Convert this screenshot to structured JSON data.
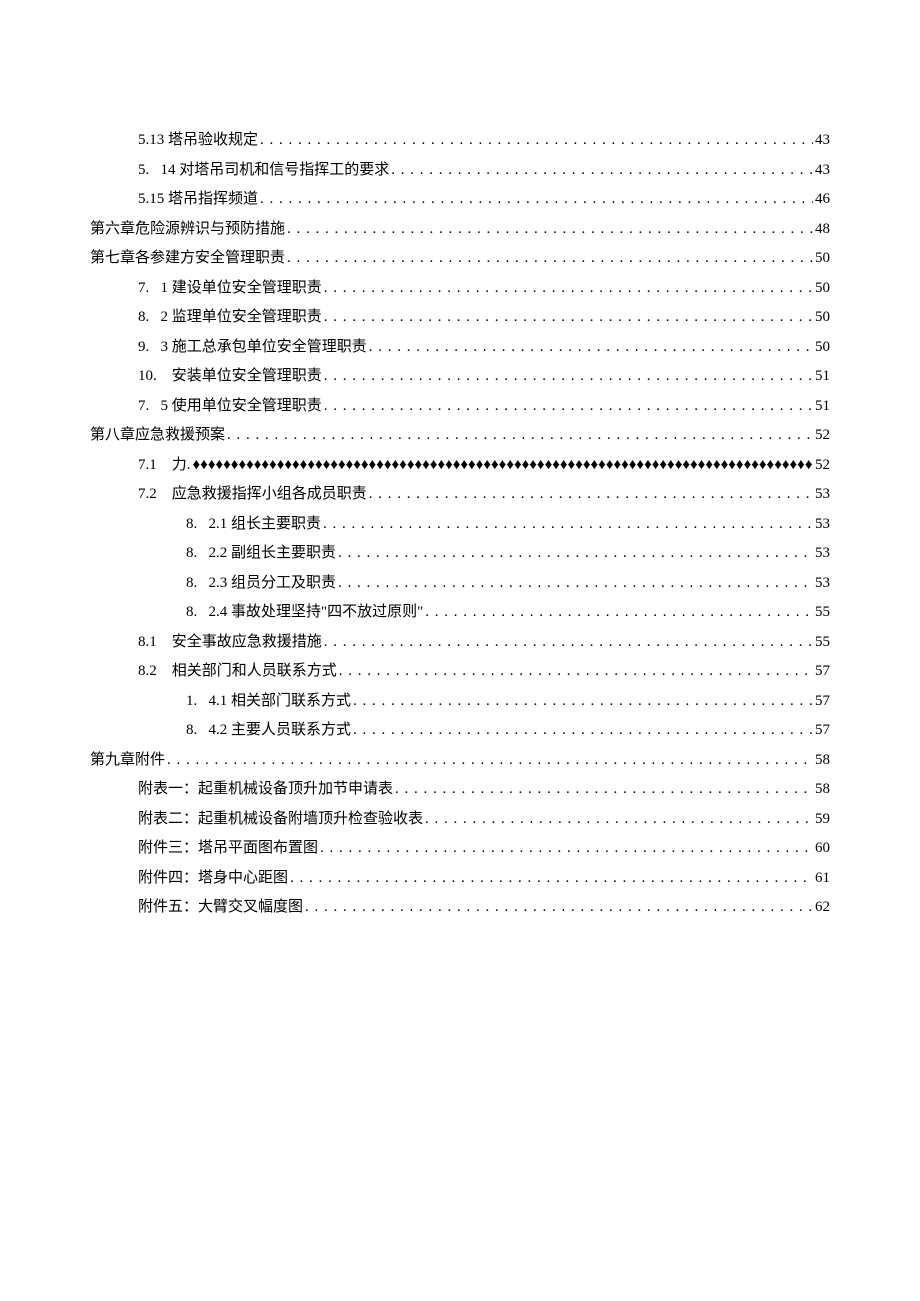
{
  "toc": [
    {
      "indent": 1,
      "prefix": "",
      "title": "5.13 塔吊验收规定",
      "page": "43",
      "leader": "dots"
    },
    {
      "indent": 1,
      "prefix": "5.   ",
      "title": "14 对塔吊司机和信号指挥工的要求",
      "page": "43",
      "leader": "dots"
    },
    {
      "indent": 1,
      "prefix": "",
      "title": "5.15 塔吊指挥频道",
      "page": "46",
      "leader": "dots"
    },
    {
      "indent": 0,
      "prefix": "",
      "title": "第六章危险源辨识与预防措施 ",
      "page": "48",
      "leader": "dots"
    },
    {
      "indent": 0,
      "prefix": "",
      "title": "第七章各参建方安全管理职责 ",
      "page": "50",
      "leader": "dots"
    },
    {
      "indent": 1,
      "prefix": "7.   ",
      "title": "1 建设单位安全管理职责",
      "page": "50",
      "leader": "dots"
    },
    {
      "indent": 1,
      "prefix": "8.   ",
      "title": "2 监理单位安全管理职责",
      "page": "50",
      "leader": "dots"
    },
    {
      "indent": 1,
      "prefix": "9.   ",
      "title": "3 施工总承包单位安全管理职责",
      "page": "50",
      "leader": "dots"
    },
    {
      "indent": 1,
      "prefix": "10.    ",
      "title": "安装单位安全管理职责 ",
      "page": "51",
      "leader": "dots"
    },
    {
      "indent": 1,
      "prefix": "7.   ",
      "title": "5 使用单位安全管理职责",
      "page": "51",
      "leader": "dots"
    },
    {
      "indent": 0,
      "prefix": "",
      "title": "第八章应急救援预案 ",
      "page": "52",
      "leader": "dots"
    },
    {
      "indent": 1,
      "prefix": "7.1    ",
      "title": "力.      ",
      "page": "52",
      "leader": "diamonds"
    },
    {
      "indent": 1,
      "prefix": "7.2    ",
      "title": "应急救援指挥小组各成员职责",
      "page": "53",
      "leader": "dots"
    },
    {
      "indent": 2,
      "prefix": "8.   ",
      "title": "2.1 组长主要职责 ",
      "page": "53",
      "leader": "dots"
    },
    {
      "indent": 2,
      "prefix": "8.   ",
      "title": "2.2 副组长主要职责 ",
      "page": "53",
      "leader": "dots"
    },
    {
      "indent": 2,
      "prefix": "8.   ",
      "title": "2.3 组员分工及职责 ",
      "page": "53",
      "leader": "dots"
    },
    {
      "indent": 2,
      "prefix": "8.   ",
      "title": "2.4 事故处理坚持\"四不放过原则\" ",
      "page": "55",
      "leader": "dots"
    },
    {
      "indent": 1,
      "prefix": "8.1    ",
      "title": "安全事故应急救援措施",
      "page": "55",
      "leader": "dots"
    },
    {
      "indent": 1,
      "prefix": "8.2    ",
      "title": "相关部门和人员联系方式",
      "page": "57",
      "leader": "dots"
    },
    {
      "indent": 2,
      "prefix": "1.   ",
      "title": "4.1 相关部门联系方式 ",
      "page": "57",
      "leader": "dots"
    },
    {
      "indent": 2,
      "prefix": "8.   ",
      "title": "4.2 主要人员联系方式 ",
      "page": "57",
      "leader": "dots"
    },
    {
      "indent": 0,
      "prefix": "",
      "title": "第九章附件 ",
      "page": "58",
      "leader": "dots"
    },
    {
      "indent": 1,
      "prefix": "",
      "title": "附表一：起重机械设备顶升加节申请表 ",
      "page": "58",
      "leader": "dots"
    },
    {
      "indent": 1,
      "prefix": "",
      "title": "附表二：起重机械设备附墙顶升检查验收表 ",
      "page": "59",
      "leader": "dots"
    },
    {
      "indent": 1,
      "prefix": "",
      "title": "附件三：塔吊平面图布置图 ",
      "page": "60",
      "leader": "dots"
    },
    {
      "indent": 1,
      "prefix": "",
      "title": "附件四：塔身中心距图 ",
      "page": "61",
      "leader": "dots"
    },
    {
      "indent": 1,
      "prefix": "",
      "title": "附件五：大臂交叉幅度图 ",
      "page": "62",
      "leader": "dots"
    }
  ]
}
